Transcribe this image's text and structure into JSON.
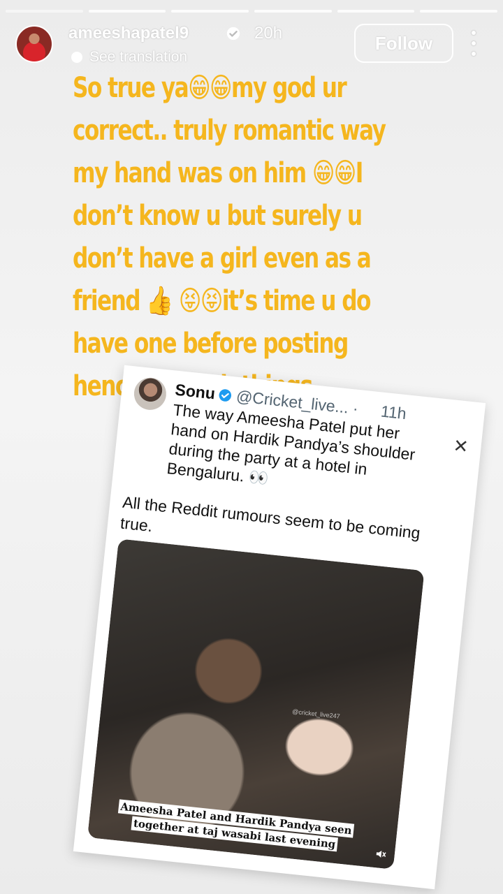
{
  "story": {
    "username": "ameeshapatel9",
    "time_ago": "20h",
    "see_translation": "See translation",
    "follow_label": "Follow",
    "caption": "So true ya😁😁my god ur correct.. truly romantic way my hand was on him 😁😁I don’t know u but surely u don’t have a girl even as a friend 👍 😝😝it’s time u do have one before posting  hence on such things ..",
    "progress_segments": 6,
    "active_segment": 0
  },
  "tweet": {
    "name": "Sonu",
    "handle": "@Cricket_live... ·",
    "time": "11h",
    "close_glyph": "✕",
    "text_line1": "The way Ameesha Patel put her hand on Hardik Pandya’s shoulder during the party at a hotel in Bengaluru. 👀",
    "text_line2": "All the Reddit rumours seem to be coming true.",
    "photo_watermark": "@cricket_live247",
    "photo_caption": "Ameesha Patel and Hardik Pandya seen together at taj wasabi last evening"
  },
  "colors": {
    "caption_yellow": "#f5b61e",
    "verified_blue": "#1d9bf0",
    "background": "#eeeeee"
  },
  "icons": {
    "verified": "verified-badge-icon",
    "more": "more-vertical-icon",
    "close": "close-icon",
    "translate": "translate-icon",
    "mute": "mute-icon"
  }
}
